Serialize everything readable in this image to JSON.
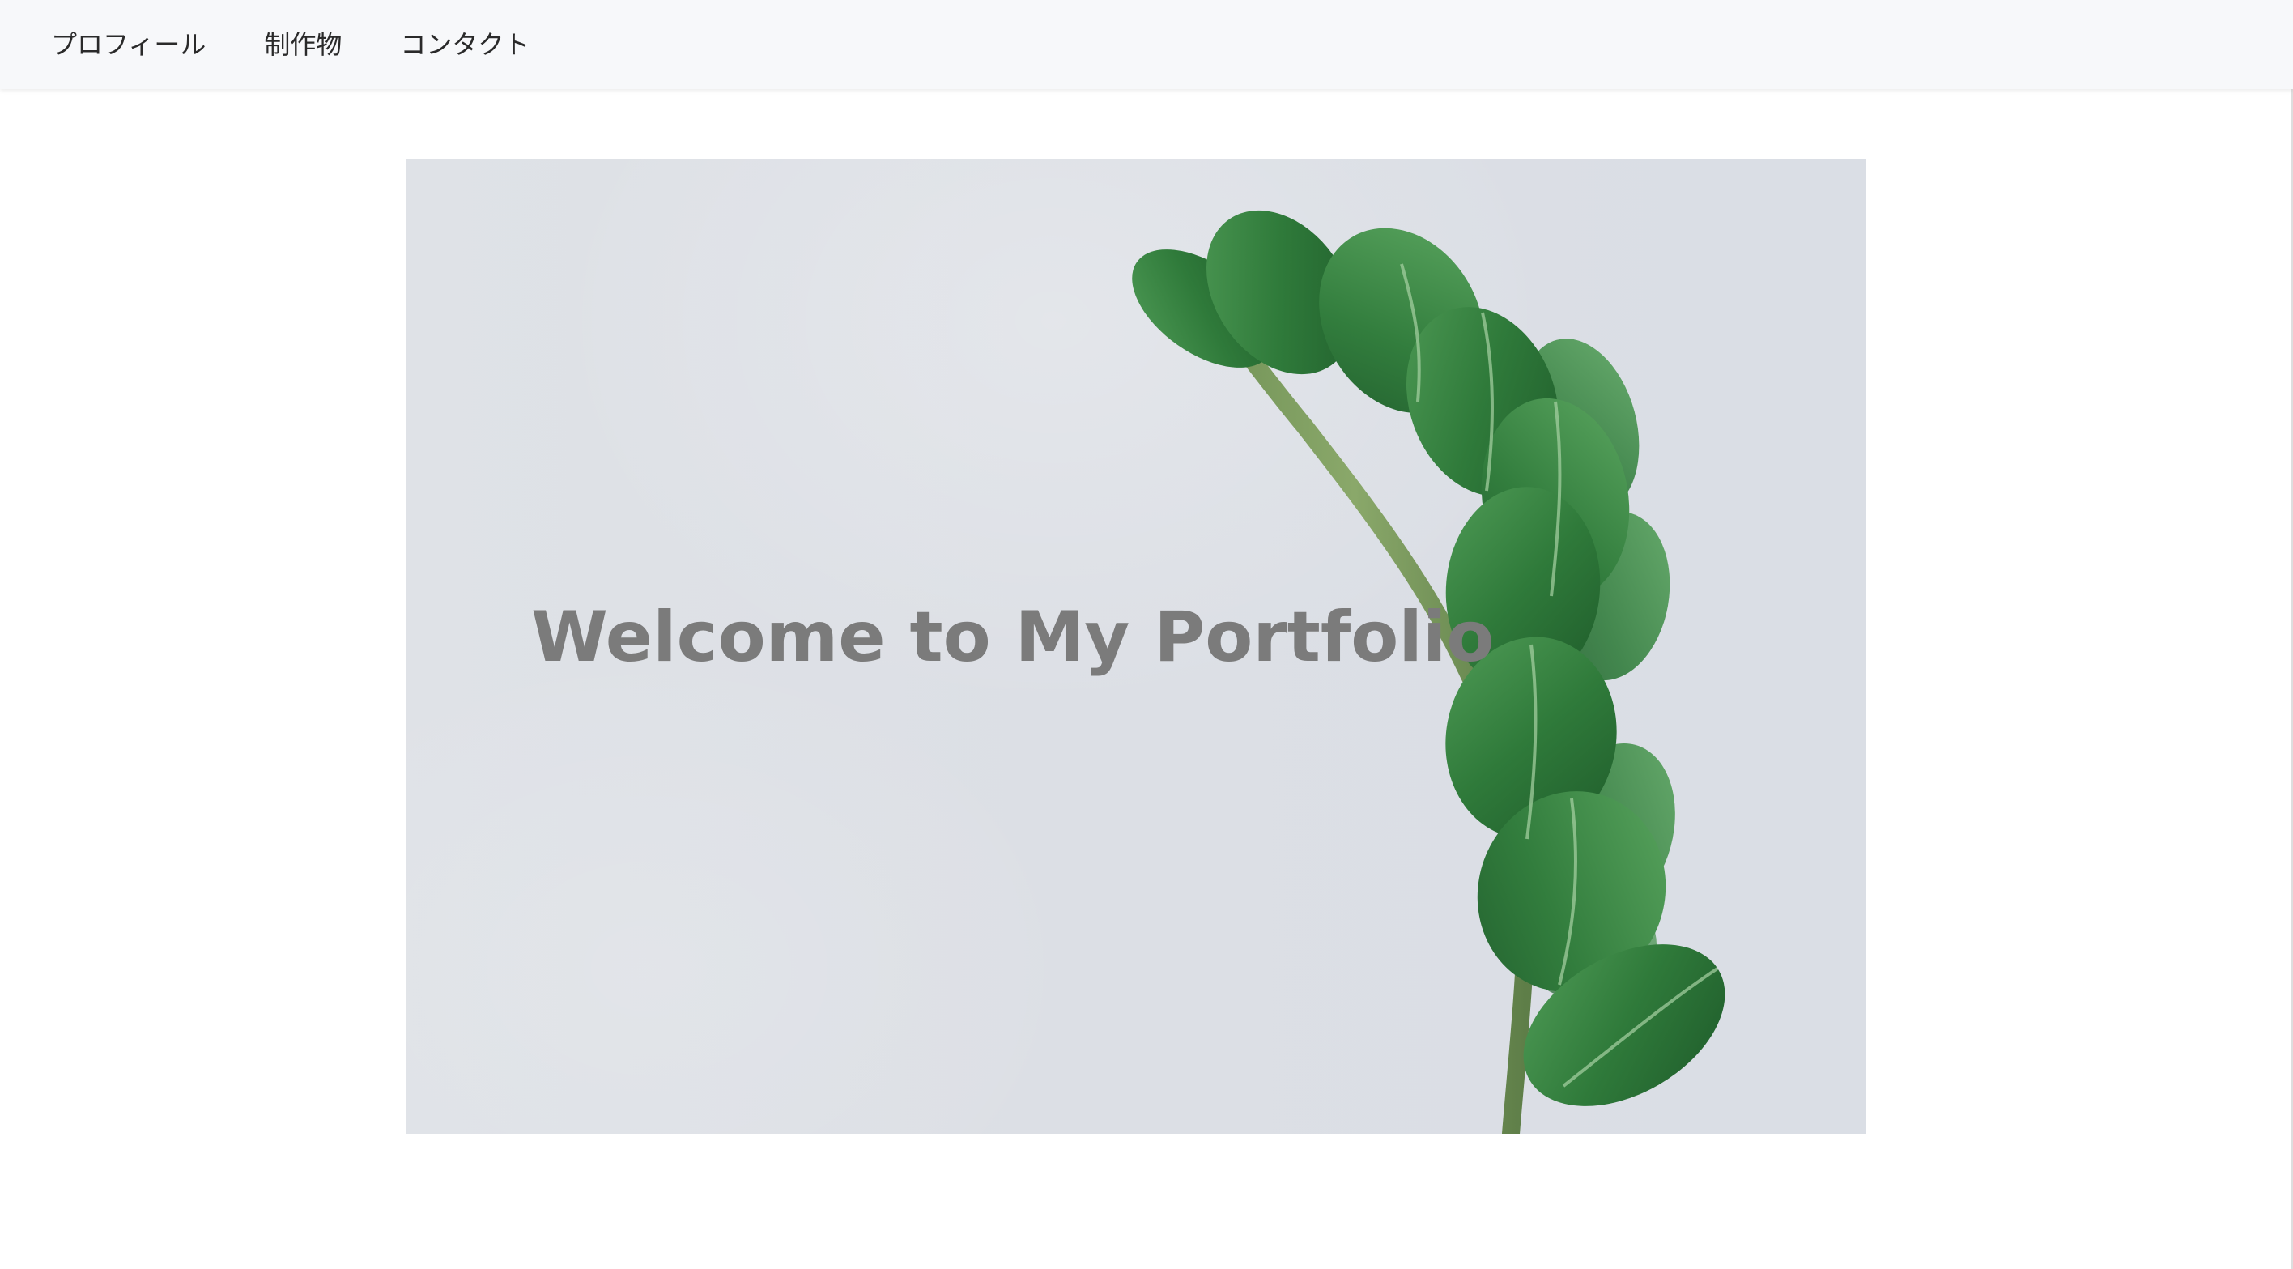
{
  "nav": {
    "items": [
      {
        "label": "プロフィール"
      },
      {
        "label": "制作物"
      },
      {
        "label": "コンタクト"
      }
    ]
  },
  "hero": {
    "title": "Welcome to My Portfolio"
  },
  "colors": {
    "navbar_bg": "#f7f8fa",
    "hero_bg": "#dcdfe5",
    "title_text": "#7b7b7b",
    "leaf_green": "#2f7a3a"
  }
}
